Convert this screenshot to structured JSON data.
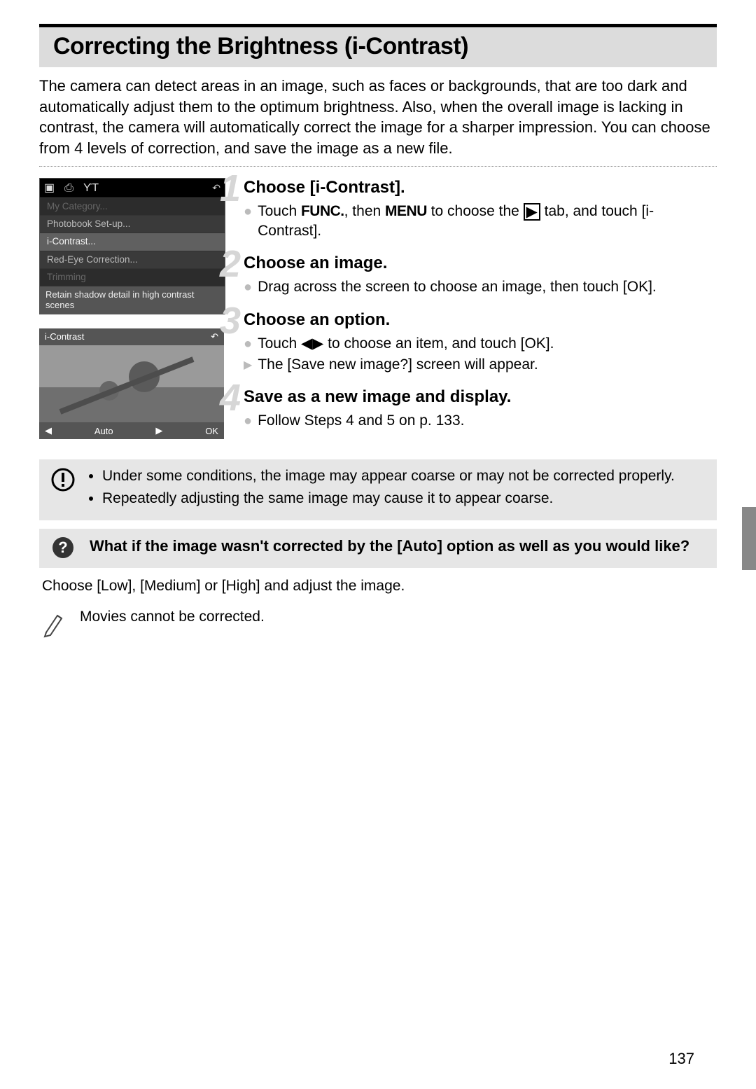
{
  "title": "Correcting the Brightness (i-Contrast)",
  "intro": "The camera can detect areas in an image, such as faces or backgrounds, that are too dark and automatically adjust them to the optimum brightness. Also, when the overall image is lacking in contrast, the camera will automatically correct the image for a sharper impression. You can choose from 4 levels of correction, and save the image as a new file.",
  "cam_menu": {
    "rows": {
      "category": "My Category...",
      "photobook": "Photobook Set-up...",
      "icontrast": "i-Contrast...",
      "redeye": "Red-Eye Correction...",
      "trimming": "Trimming"
    },
    "hint": "Retain shadow detail in high contrast scenes",
    "back_icon": "↶"
  },
  "preview": {
    "title": "i-Contrast",
    "back": "↶",
    "left": "◀",
    "mode": "Auto",
    "right": "▶",
    "ok": "OK"
  },
  "steps": {
    "s1": {
      "num": "1",
      "title": "Choose [i-Contrast].",
      "line1a": "Touch ",
      "func": "FUNC.",
      "line1b": ", then ",
      "menu": "MENU",
      "line1c": " to choose the ",
      "play": "▶",
      "line1d": " tab, and touch [i-Contrast]."
    },
    "s2": {
      "num": "2",
      "title": "Choose an image.",
      "body": "Drag across the screen to choose an image, then touch [OK]."
    },
    "s3": {
      "num": "3",
      "title": "Choose an option.",
      "line1a": "Touch ",
      "arrows": "◀▶",
      "line1b": " to choose an item, and touch [OK].",
      "line2": "The [Save new image?] screen will appear."
    },
    "s4": {
      "num": "4",
      "title": "Save as a new image and display.",
      "body": "Follow Steps 4 and 5 on p. 133."
    }
  },
  "warning": {
    "item1": "Under some conditions, the image may appear coarse or may not be corrected properly.",
    "item2": "Repeatedly adjusting the same image may cause it to appear coarse."
  },
  "question": "What if the image wasn't corrected by the [Auto] option as well as you would like?",
  "answer": "Choose [Low], [Medium] or [High] and adjust the image.",
  "pencil_note": "Movies cannot be corrected.",
  "page_number": "137"
}
